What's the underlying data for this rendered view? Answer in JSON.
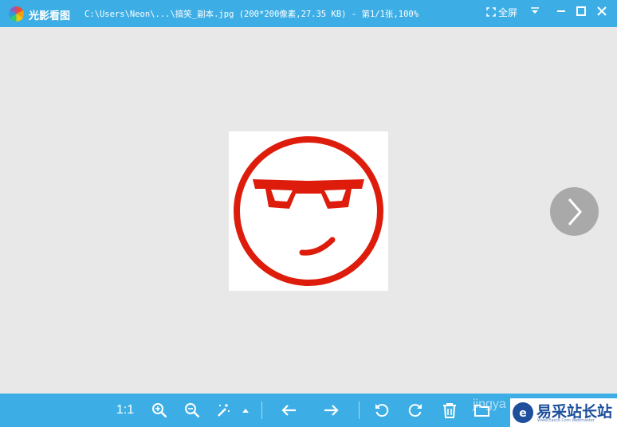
{
  "window": {
    "app_name": "光影看图",
    "file_title": "C:\\Users\\Neon\\...\\搞笑_副本.jpg (200*200像素,27.35 KB) - 第1/1张,100%",
    "fullscreen_label": "全屏"
  },
  "toolbar": {
    "actual_size_label": "1:1",
    "watermark_text": "jingya"
  },
  "site_logo": {
    "name": "易采站长站",
    "tagline": "Www.Easck.Com Webmaster"
  },
  "colors": {
    "accent": "#3daee5",
    "viewer_bg": "#e8e8e8",
    "emoji_red": "#dd1c0c"
  },
  "icons": [
    "app-logo-icon",
    "fullscreen-icon",
    "menu-chevron-icon",
    "minimize-icon",
    "maximize-icon",
    "close-icon",
    "chevron-right-icon",
    "zoom-in-icon",
    "zoom-out-icon",
    "magic-wand-icon",
    "caret-up-icon",
    "arrow-left-icon",
    "arrow-right-icon",
    "rotate-left-icon",
    "rotate-right-icon",
    "trash-icon",
    "folder-icon"
  ]
}
